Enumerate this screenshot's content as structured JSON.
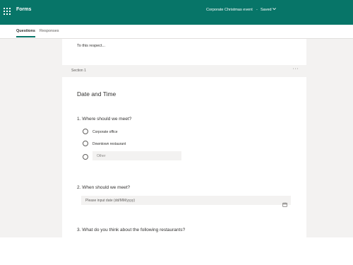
{
  "app": {
    "name": "Forms",
    "waffle_icon": "waffle-icon",
    "form_title": "Corporate Christmas event",
    "separator": "-",
    "save_status": "Saved",
    "chevron_icon": "chevron-down-icon",
    "accent_color": "#077568"
  },
  "tabs": [
    {
      "label": "Questions",
      "active": true
    },
    {
      "label": "Responses",
      "active": false
    }
  ],
  "form": {
    "previous_text": "To this respect...",
    "section": {
      "label": "Section 1",
      "more": "···",
      "title": "Date and Time"
    },
    "questions": [
      {
        "title": "1. Where should we meet?",
        "options": [
          "Corporate office",
          "Downtown restaurant"
        ],
        "other_placeholder": "Other"
      },
      {
        "title": "2. When should we meet?",
        "date_placeholder": "Please input date (dd/MM/yyyy)",
        "calendar_icon": "calendar-icon"
      },
      {
        "title": "3. What do you think about the following restaurants?"
      }
    ]
  }
}
